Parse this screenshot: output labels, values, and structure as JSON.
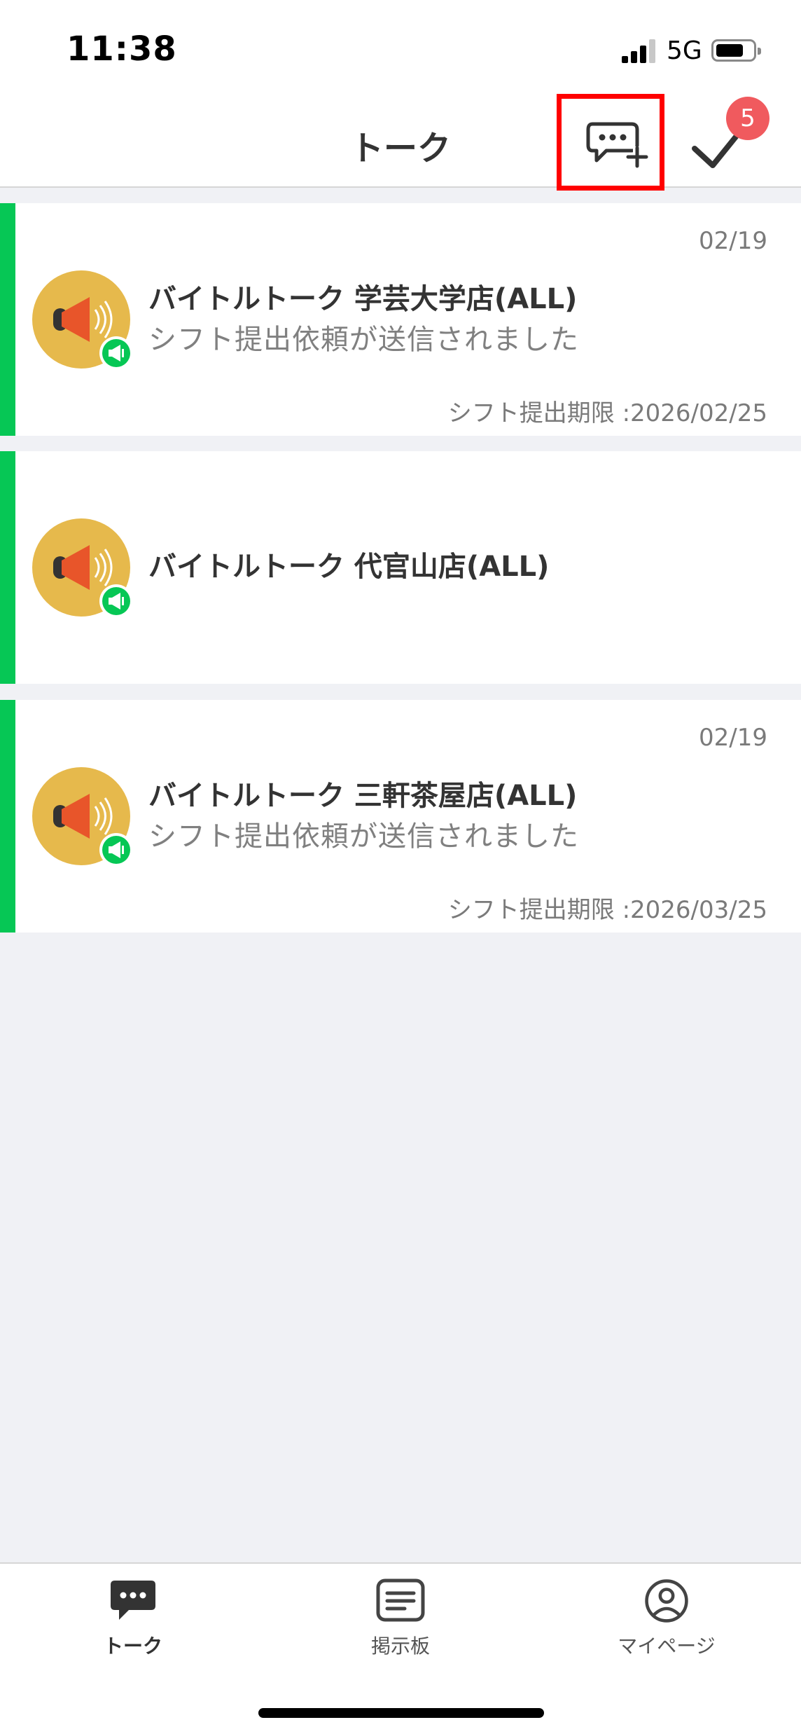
{
  "status_bar": {
    "time": "11:38",
    "network": "5G"
  },
  "header": {
    "title": "トーク",
    "badge_count": "5",
    "new_chat_icon": "chat-plus-icon",
    "check_icon": "checkmark-icon"
  },
  "talks": [
    {
      "date": "02/19",
      "name": "バイトルトーク 学芸大学店(ALL)",
      "message": "シフト提出依頼が送信されました",
      "deadline": "シフト提出期限 :2026/02/25"
    },
    {
      "date": "",
      "name": "バイトルトーク 代官山店(ALL)",
      "message": "",
      "deadline": ""
    },
    {
      "date": "02/19",
      "name": "バイトルトーク 三軒茶屋店(ALL)",
      "message": "シフト提出依頼が送信されました",
      "deadline": "シフト提出期限 :2026/03/25"
    }
  ],
  "tabs": [
    {
      "label": "トーク",
      "icon": "chat-bubble-icon",
      "active": true
    },
    {
      "label": "掲示板",
      "icon": "board-icon",
      "active": false
    },
    {
      "label": "マイページ",
      "icon": "user-circle-icon",
      "active": false
    }
  ],
  "colors": {
    "accent": "#06c755",
    "badge": "#f05a5e",
    "highlight": "#ff0000",
    "avatar_bg": "#e6b94c",
    "speaker": "#e8552a"
  }
}
